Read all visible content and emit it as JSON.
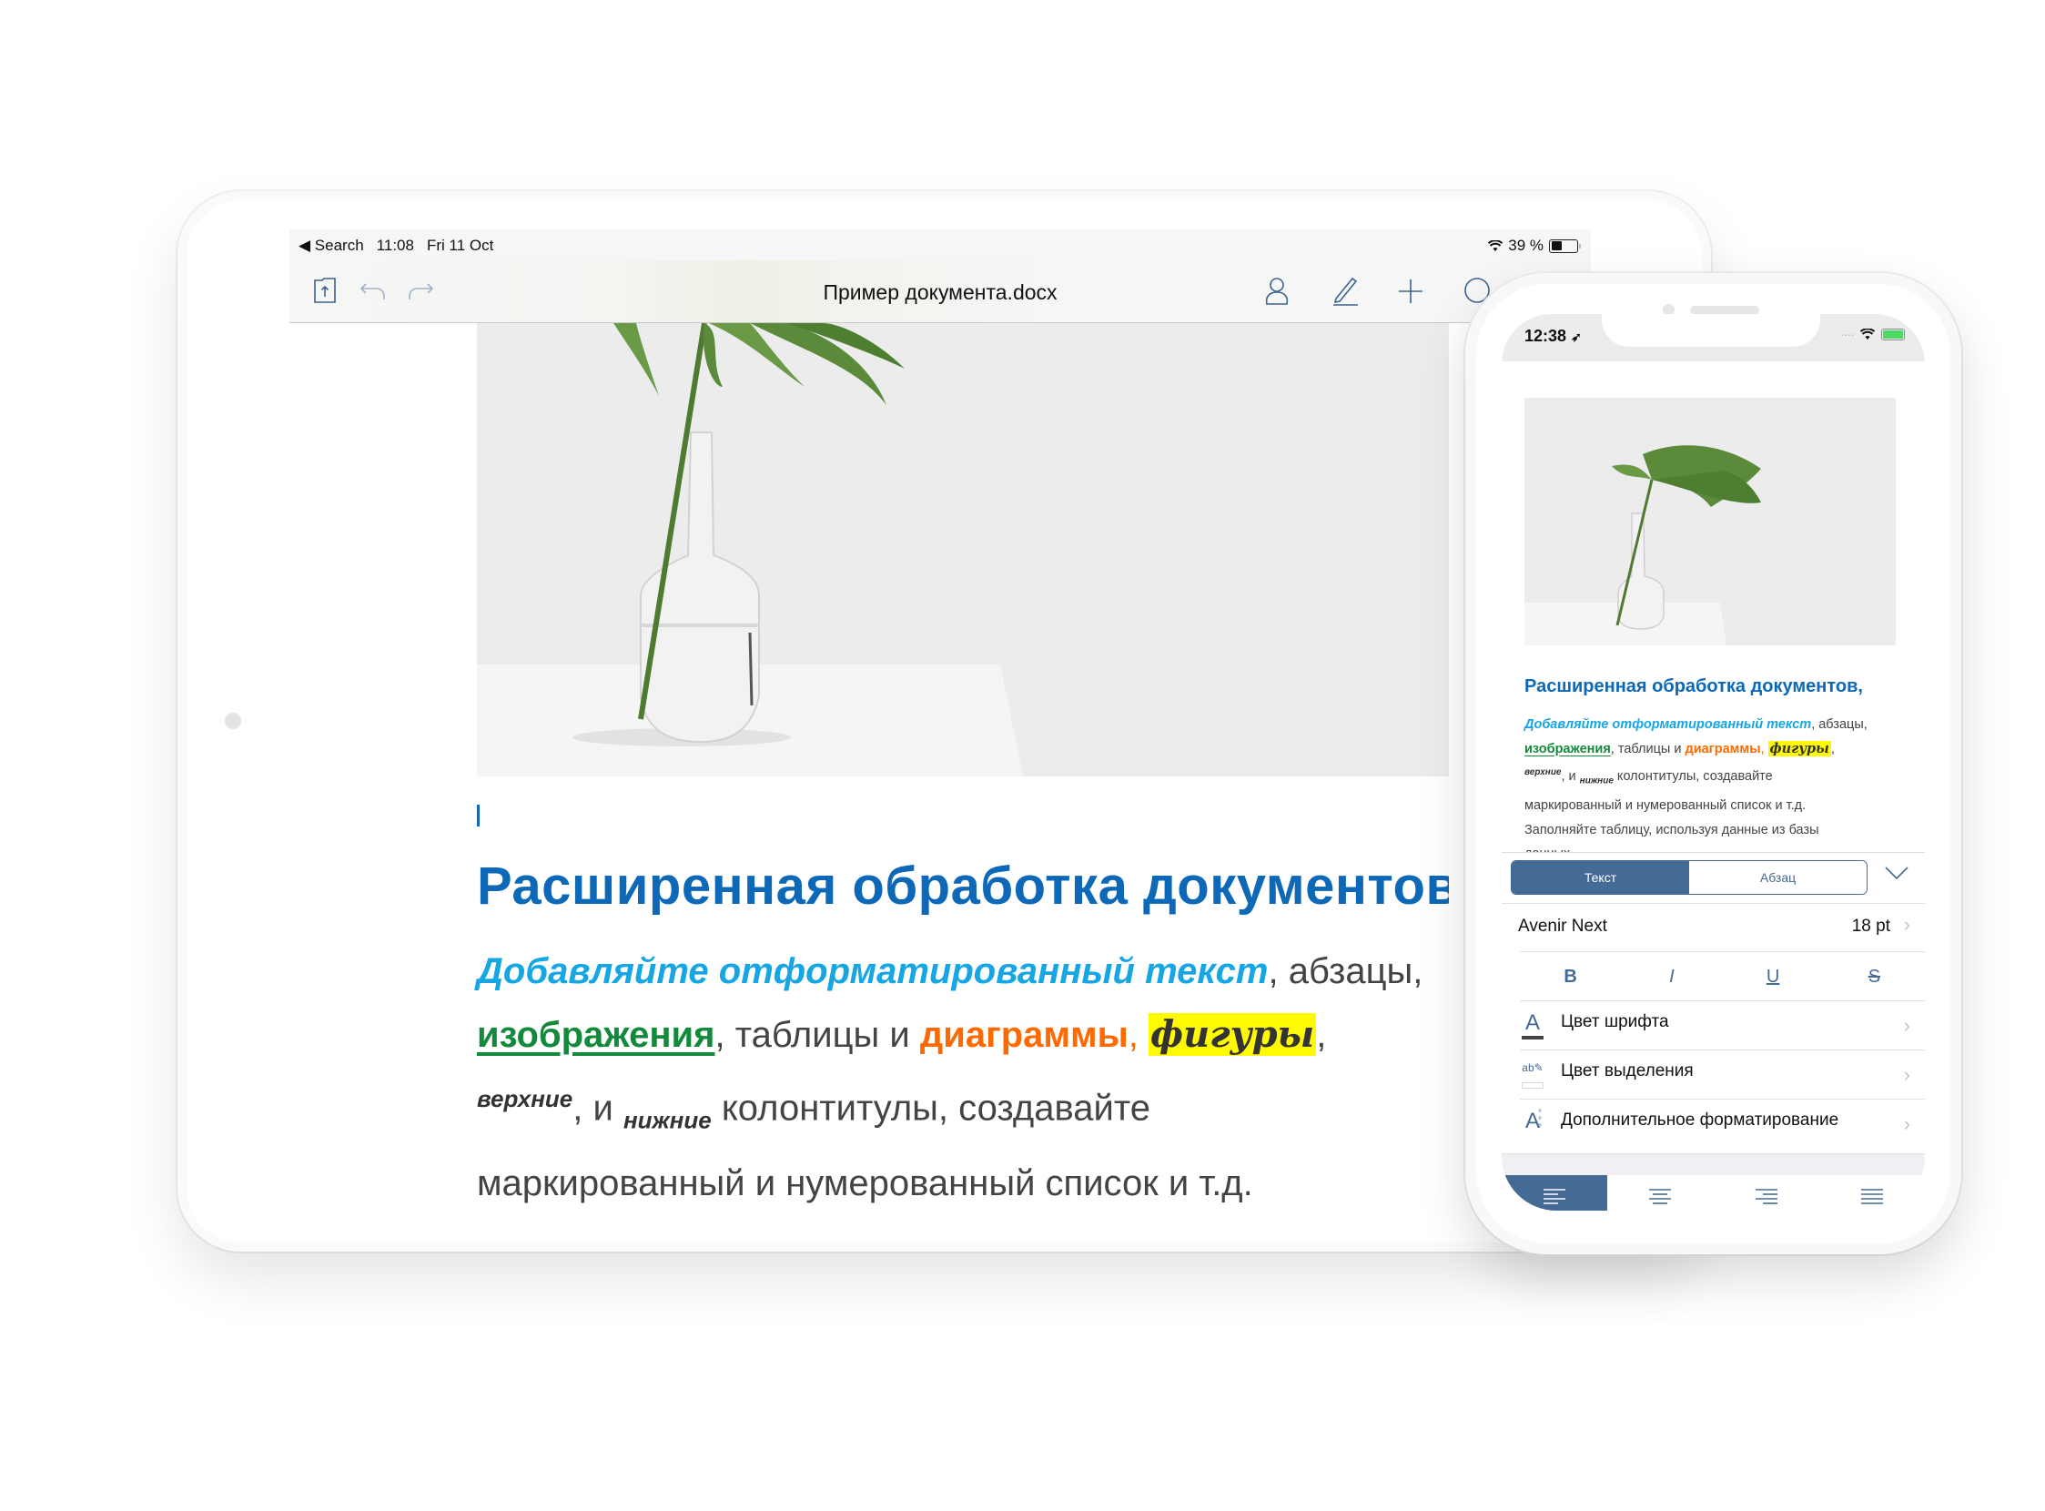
{
  "ipad": {
    "status_bar": {
      "back_label": "◀ Search",
      "time": "11:08",
      "date": "Fri 11 Oct",
      "battery_text": "39 %",
      "battery_level": 0.39
    },
    "toolbar": {
      "title": "Пример документа.docx",
      "icons": [
        "folder-upload-icon",
        "undo-icon",
        "redo-icon",
        "user-icon",
        "pencil-icon",
        "plus-icon",
        "circle-icon"
      ]
    },
    "document": {
      "image_alt": "plant-in-vase-photo",
      "heading": "Расширенная обработка документов",
      "body": {
        "cyan_text": "Добавляйте отформатированный текст",
        "after_cyan": ",  абзацы,",
        "green_text": "изображения",
        "after_green": ", таблицы и ",
        "orange_text": "диаграммы",
        "orange_comma": ",",
        "script_text": "фигуры",
        "after_script": ",",
        "sup_text": "верхние",
        "mid_text": ", и ",
        "sub_text": "нижние",
        "after_sub": " колонтитулы, создавайте",
        "line4": "маркированный и нумерованный список и т.д."
      }
    }
  },
  "iphone": {
    "status_bar": {
      "time": "12:38",
      "battery_level": 0.9
    },
    "document": {
      "image_alt": "plant-in-vase-photo",
      "heading": "Расширенная обработка документов,",
      "body": {
        "cyan_text": "Добавляйте отформатированный текст",
        "after_cyan": ",  абзацы,",
        "green_text": "изображения",
        "after_green": ", таблицы и ",
        "orange_text": "диаграммы",
        "orange_comma": ", ",
        "script_text": "фигуры",
        "after_script": ",",
        "sup_text": "верхние",
        "mid_text": ", и ",
        "sub_text": "нижние",
        "after_sub": " колонтитулы, создавайте",
        "line4": "маркированный и нумерованный список и т.д.",
        "line5": "Заполняйте таблицу, используя данные из базы",
        "line6": "данных."
      }
    },
    "format_panel": {
      "tabs": [
        {
          "label": "Текст",
          "active": true
        },
        {
          "label": "Абзац",
          "active": false
        }
      ],
      "font_name": "Avenir Next",
      "font_size": "18 pt",
      "style_buttons": [
        "B",
        "I",
        "U",
        "S"
      ],
      "rows": [
        {
          "icon": "font-color-icon",
          "label": "Цвет шрифта"
        },
        {
          "icon": "highlight-color-icon",
          "label": "Цвет выделения"
        },
        {
          "icon": "more-formatting-icon",
          "label": "Дополнительное форматирование"
        }
      ],
      "alignment": [
        "align-left",
        "align-center",
        "align-right",
        "align-justify"
      ],
      "active_alignment": "align-left"
    }
  },
  "colors": {
    "heading_blue": "#0e68b8",
    "cyan": "#16a6e4",
    "green": "#138a3b",
    "orange": "#ff6a00",
    "highlight_yellow": "#fffa00",
    "ui_accent": "#446a96"
  }
}
